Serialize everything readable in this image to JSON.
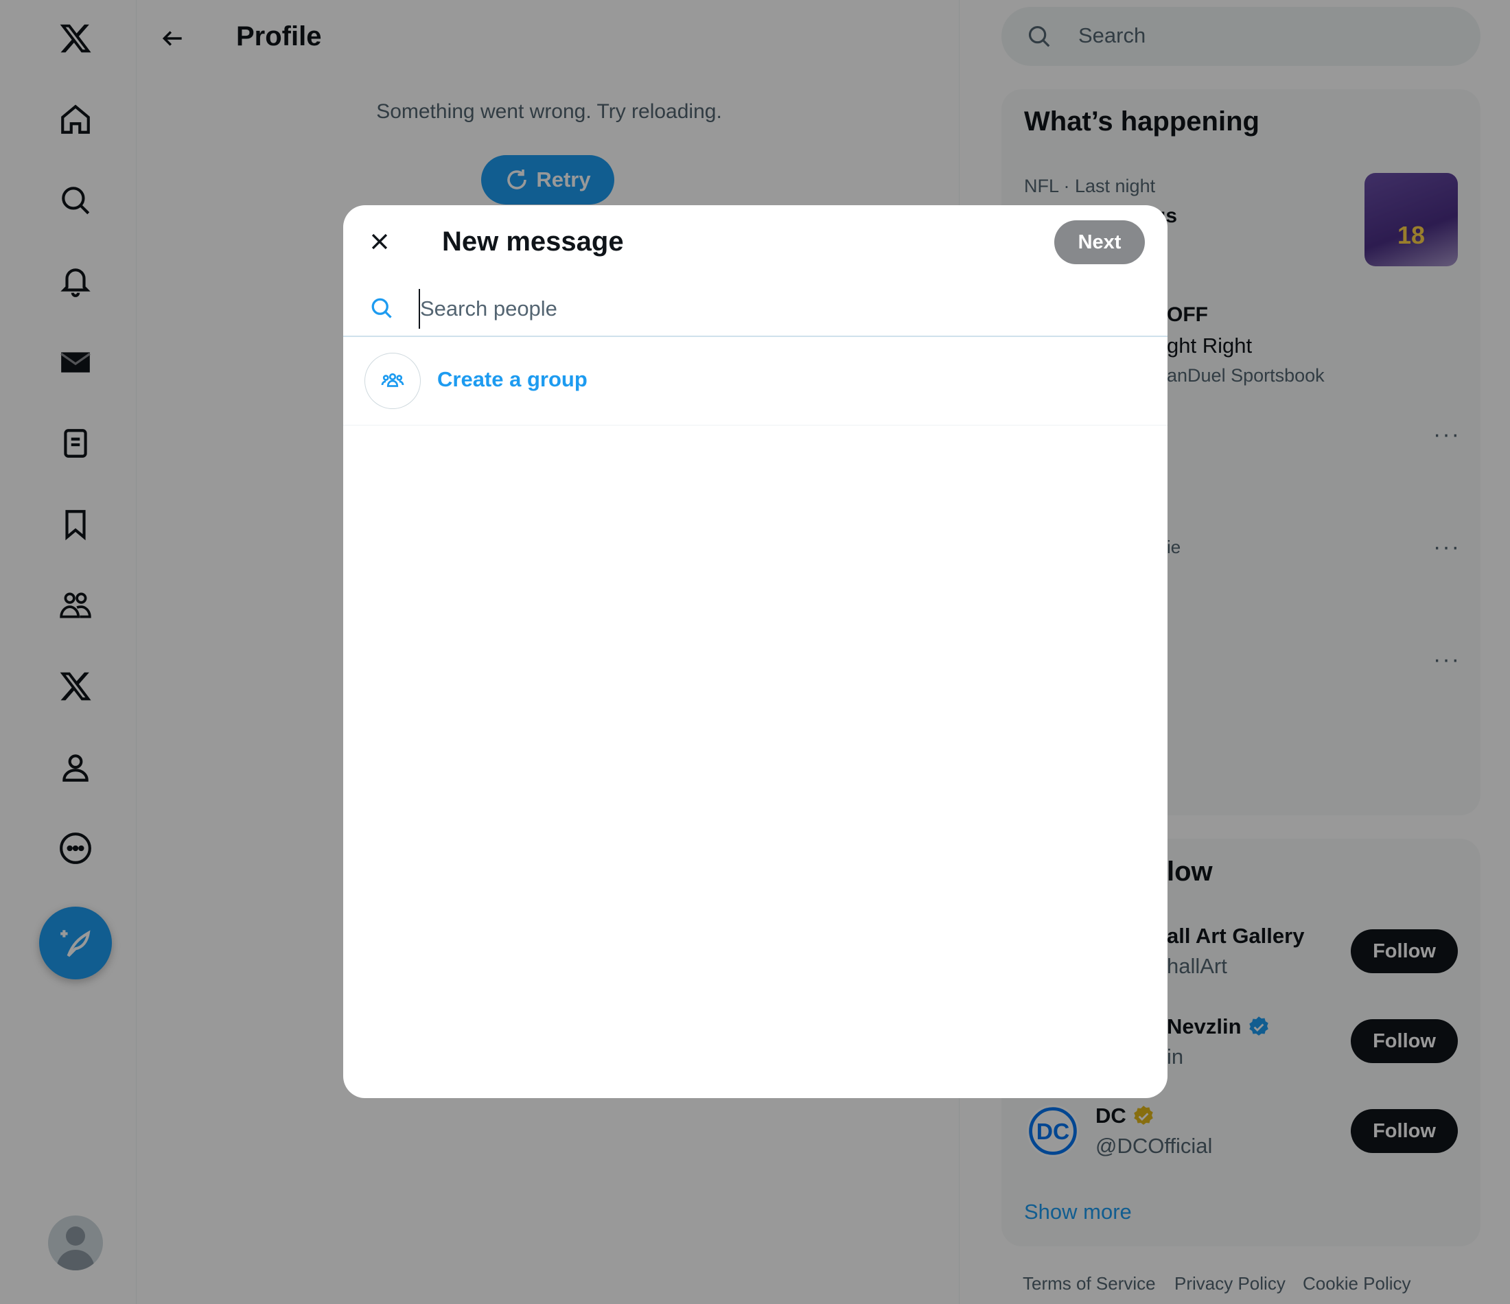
{
  "left_nav": {
    "items": [
      "x-logo",
      "home",
      "explore",
      "notifications",
      "messages",
      "lists",
      "bookmarks",
      "communities",
      "premium",
      "profile",
      "more"
    ]
  },
  "main": {
    "title": "Profile",
    "error_text": "Something went wrong. Try reloading.",
    "retry_label": "Retry"
  },
  "right": {
    "search_placeholder": "Search",
    "whats_happening": {
      "title": "What’s happening",
      "trend1_meta": "NFL · Last night",
      "trend1_title_fragment": "gs",
      "trend2_title_fragment": "OFF",
      "trend2_sub_fragment": "ght Right",
      "trend2_promo_fragment": "anDuel Sportsbook",
      "trend3_fragment": "ie"
    },
    "who_to_follow": {
      "title_fragment": "low",
      "accounts": [
        {
          "name": "all Art Gallery",
          "handle": "hallArt",
          "follow": "Follow"
        },
        {
          "name": "Nevzlin",
          "handle": "in",
          "follow": "Follow"
        },
        {
          "name": "DC",
          "handle": "@DCOfficial",
          "follow": "Follow"
        }
      ],
      "show_more": "Show more"
    },
    "footer": [
      "Terms of Service",
      "Privacy Policy",
      "Cookie Policy"
    ]
  },
  "modal": {
    "title": "New message",
    "next_label": "Next",
    "search_placeholder": "Search people",
    "create_group_label": "Create a group"
  },
  "colors": {
    "accent": "#1d9bf0",
    "overlay": "rgba(0,0,0,0.4)",
    "next_disabled": "#87898c"
  }
}
